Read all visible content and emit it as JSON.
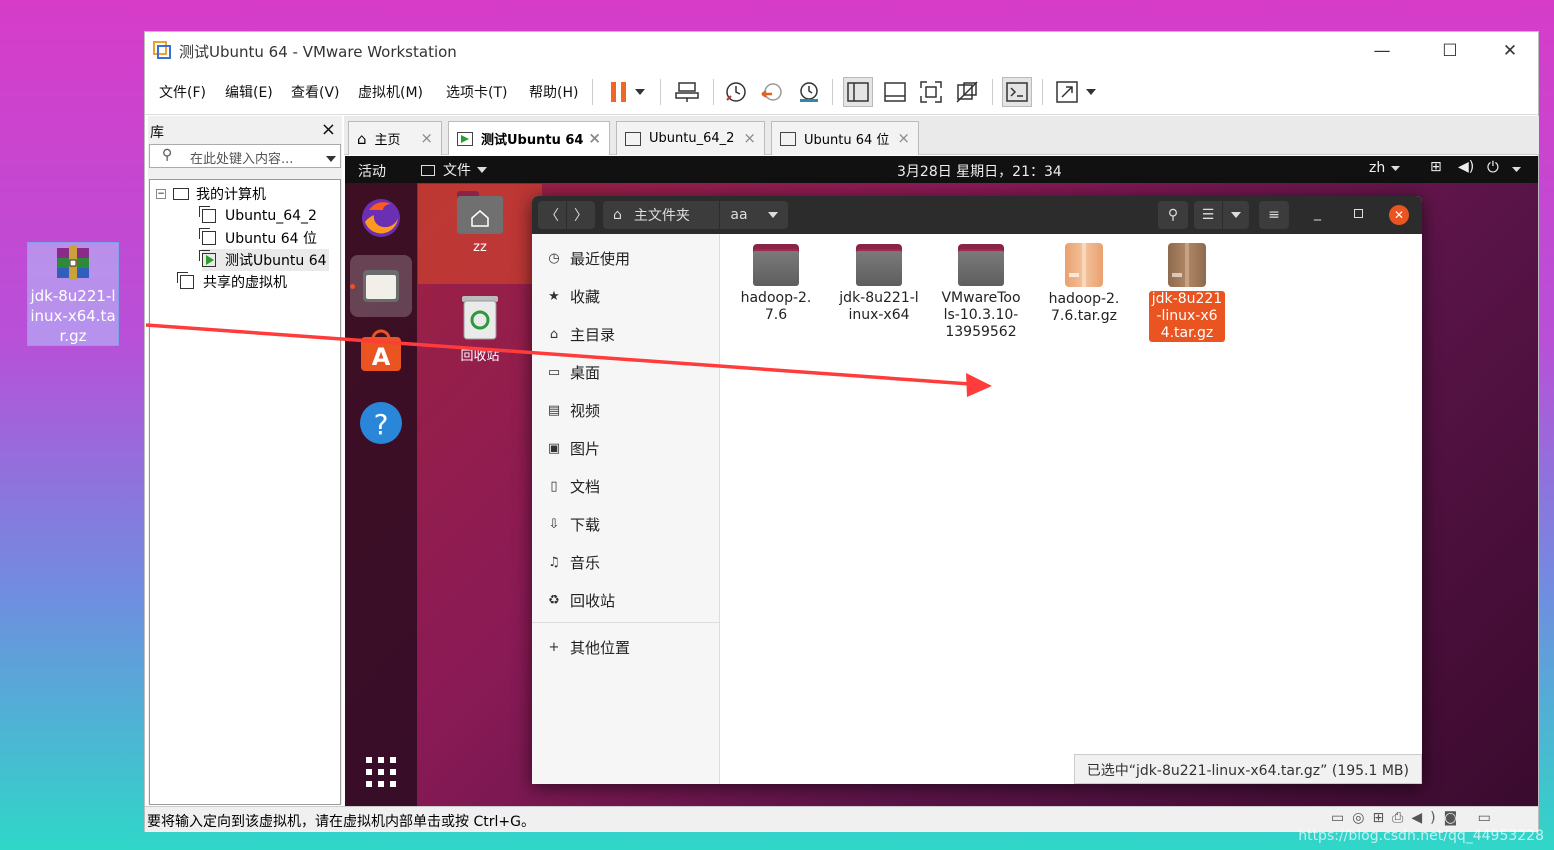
{
  "desktop": {
    "file_label": "jdk-8u221-linux-x64.tar.gz"
  },
  "window": {
    "title": "测试Ubuntu 64 - VMware Workstation",
    "min": "—",
    "max": "☐",
    "close": "✕"
  },
  "menu": [
    "文件(F)",
    "编辑(E)",
    "查看(V)",
    "虚拟机(M)",
    "选项卡(T)",
    "帮助(H)"
  ],
  "library": {
    "title": "库",
    "search_placeholder": "在此处键入内容...",
    "tree": {
      "root": "我的计算机",
      "vms": [
        "Ubuntu_64_2",
        "Ubuntu 64 位",
        "测试Ubuntu 64"
      ],
      "shared": "共享的虚拟机"
    }
  },
  "tabs": [
    {
      "label": "主页"
    },
    {
      "label": "测试Ubuntu 64"
    },
    {
      "label": "Ubuntu_64_2"
    },
    {
      "label": "Ubuntu 64 位"
    }
  ],
  "ubuntu": {
    "activities": "活动",
    "app_menu": "文件",
    "clock": "3月28日 星期日，21：34",
    "lang": "zh",
    "desktop_icons": {
      "home": "zz",
      "trash": "回收站"
    }
  },
  "nautilus": {
    "path_home": "主文件夹",
    "path_current": "aa",
    "sidebar": [
      "最近使用",
      "收藏",
      "主目录",
      "桌面",
      "视频",
      "图片",
      "文档",
      "下载",
      "音乐",
      "回收站"
    ],
    "other_locations": "其他位置",
    "files": [
      {
        "name": "hadoop-2.7.6",
        "type": "folder"
      },
      {
        "name": "jdk-8u221-linux-x64",
        "type": "folder"
      },
      {
        "name": "VMwareTools-10.3.10-13959562",
        "type": "folder"
      },
      {
        "name": "hadoop-2.7.6.tar.gz",
        "type": "archive"
      },
      {
        "name": "jdk-8u221-linux-x64.tar.gz",
        "type": "archive",
        "selected": true
      }
    ],
    "status": "已选中“jdk-8u221-linux-x64.tar.gz” (195.1 MB)"
  },
  "vm_status": "要将输入定向到该虚拟机，请在虚拟机内部单击或按 Ctrl+G。",
  "watermark": "https://blog.csdn.net/qq_44953228",
  "colors": {
    "accent": "#e95420",
    "arrow": "#ff3b3b",
    "pause": "#f26522"
  }
}
